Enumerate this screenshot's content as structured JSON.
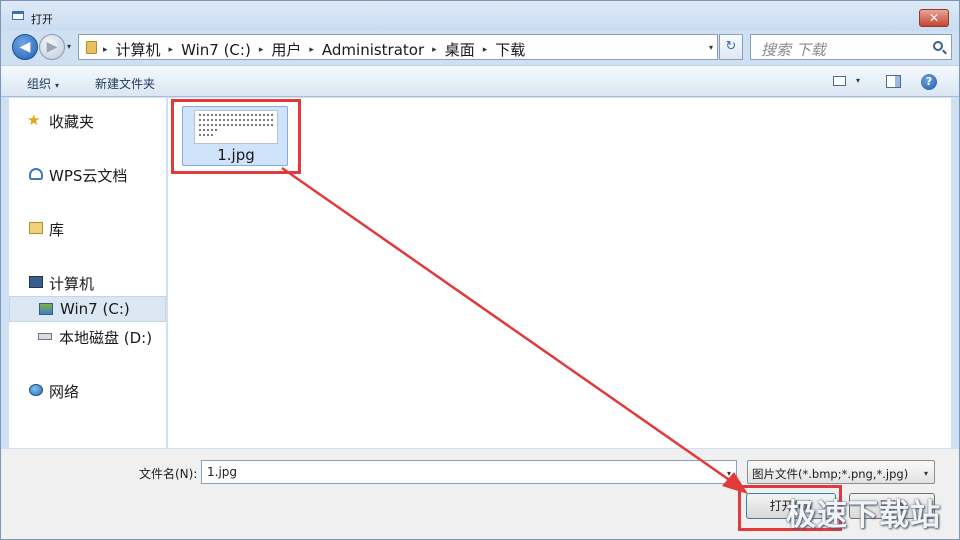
{
  "window": {
    "title": "打开",
    "close_symbol": "✕"
  },
  "nav": {
    "back_symbol": "◀",
    "forward_symbol": "▶",
    "dropdown_symbol": "▾",
    "breadcrumb": [
      "计算机",
      "Win7 (C:)",
      "用户",
      "Administrator",
      "桌面",
      "下载"
    ],
    "breadcrumb_sep": "▸",
    "refresh_symbol": "↻",
    "search_placeholder": "搜索 下载"
  },
  "toolbar": {
    "organize_label": "组织",
    "new_folder_label": "新建文件夹",
    "help_symbol": "?"
  },
  "sidebar": {
    "items": [
      {
        "label": "收藏夹",
        "icon": "star-icon"
      },
      {
        "label": "WPS云文档",
        "icon": "cloud-icon"
      },
      {
        "label": "库",
        "icon": "library-icon"
      },
      {
        "label": "计算机",
        "icon": "computer-icon"
      },
      {
        "label": "Win7 (C:)",
        "icon": "drive-icon",
        "selected": true
      },
      {
        "label": "本地磁盘 (D:)",
        "icon": "disk-icon"
      },
      {
        "label": "网络",
        "icon": "network-icon"
      }
    ]
  },
  "files": [
    {
      "name": "1.jpg",
      "selected": true
    }
  ],
  "footer": {
    "filename_label": "文件名(N):",
    "filename_value": "1.jpg",
    "filter_value": "图片文件(*.bmp;*.png,*.jpg)",
    "open_label": "打开(O)",
    "cancel_label": "取消"
  },
  "watermark": "极速下载站",
  "colors": {
    "highlight": "#e23a3a",
    "accent": "#3d6fb3"
  }
}
